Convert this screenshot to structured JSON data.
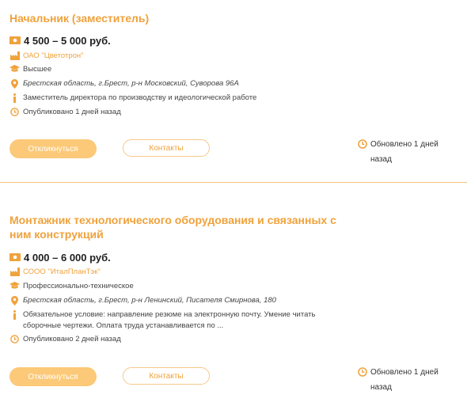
{
  "colors": {
    "accent": "#f0a23c",
    "button_fill": "#fbc978",
    "divider": "#f2c57a"
  },
  "vacancies": [
    {
      "title": "Начальник (заместитель)",
      "salary": "4 500 – 5 000 руб.",
      "salary_icon": "money-icon",
      "company": "ОАО \"Цветотрон\"",
      "company_icon": "factory-icon",
      "education": "Высшее",
      "education_icon": "graduation-cap-icon",
      "address": "Брестская область, г.Брест, р-н Московский, Суворова 96А",
      "address_icon": "location-pin-icon",
      "info": "Заместитель директора по производству и идеологической работе",
      "info_icon": "info-icon",
      "published": "Опубликовано 1 дней назад",
      "published_icon": "clock-icon",
      "apply_label": "Откликнуться",
      "contacts_label": "Контакты",
      "updated": "Обновлено 1 дней назад",
      "updated_icon": "clock-icon"
    },
    {
      "title": "Монтажник технологического оборудования и связанных с ним конструкций",
      "salary": "4 000 – 6 000 руб.",
      "salary_icon": "money-icon",
      "company": "СООО \"ИталПланТэк\"",
      "company_icon": "factory-icon",
      "education": "Профессионально-техническое",
      "education_icon": "graduation-cap-icon",
      "address": "Брестская область, г.Брест, р-н Ленинский, Писателя Смирнова, 180",
      "address_icon": "location-pin-icon",
      "info": "Обязательное условие: направление резюме на электронную почту. Умение читать сборочные чертежи. Оплата труда устанавливается по ...",
      "info_icon": "info-icon",
      "published": "Опубликовано 2 дней назад",
      "published_icon": "clock-icon",
      "apply_label": "Откликнуться",
      "contacts_label": "Контакты",
      "updated": "Обновлено 1 дней назад",
      "updated_icon": "clock-icon"
    }
  ]
}
